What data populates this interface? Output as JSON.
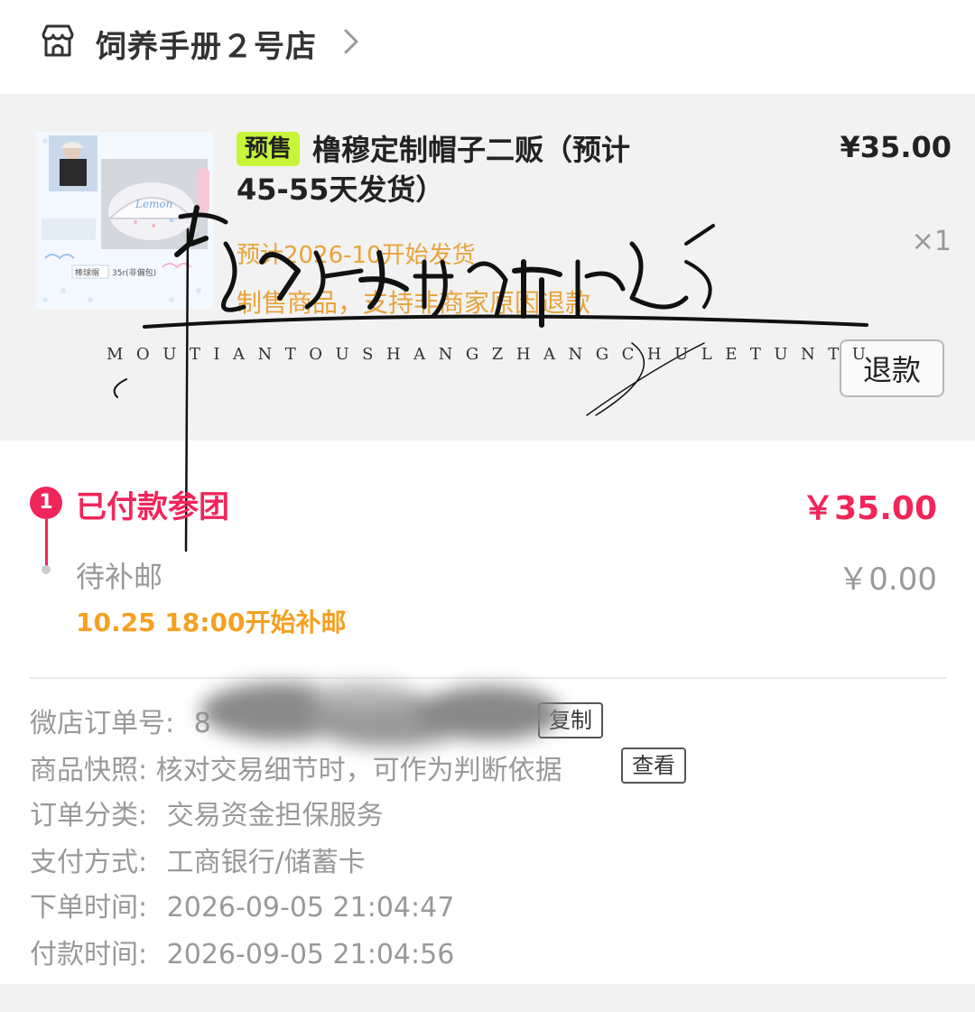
{
  "store": {
    "name": "饲养手册２号店",
    "icon": "store-icon",
    "chevron_icon": "chevron-right-icon"
  },
  "product": {
    "badge": "预售",
    "title": "橹穆定制帽子二贩（预计45-55天发货）",
    "price": "¥35.00",
    "quantity": "×1",
    "ship_hint": "预计2026-10开始发货",
    "refund_note": "制售商品，支持非商家原因退款",
    "refund_button": "退款",
    "thumbnail_labels": [
      "棒球帽",
      "35r(非偏包)"
    ]
  },
  "watermark": {
    "subtitle": "MOUTIANTOUSHANGZHANGCHULETUNTU"
  },
  "payment_steps": [
    {
      "index": "1",
      "title": "已付款参团",
      "amount": "￥35.00",
      "status": "active"
    },
    {
      "title": "待补邮",
      "amount": "￥0.00",
      "note": "10.25 18:00开始补邮",
      "status": "pending"
    }
  ],
  "order_details": {
    "order_no": {
      "label": "微店订单号:",
      "value": "8",
      "copy_button": "复制"
    },
    "snapshot": {
      "label": "商品快照:",
      "value": "核对交易细节时，可作为判断依据",
      "button": "查看"
    },
    "category": {
      "label": "订单分类:",
      "value": "交易资金担保服务"
    },
    "payment_method": {
      "label": "支付方式:",
      "value": "工商银行/储蓄卡"
    },
    "order_time": {
      "label": "下单时间:",
      "value": "2026-09-05 21:04:47"
    },
    "pay_time": {
      "label": "付款时间:",
      "value": "2026-09-05 21:04:56"
    }
  },
  "colors": {
    "accent_red": "#f0265a",
    "accent_orange": "#f5a020",
    "badge_green": "#c6f53a",
    "muted": "#999999"
  }
}
